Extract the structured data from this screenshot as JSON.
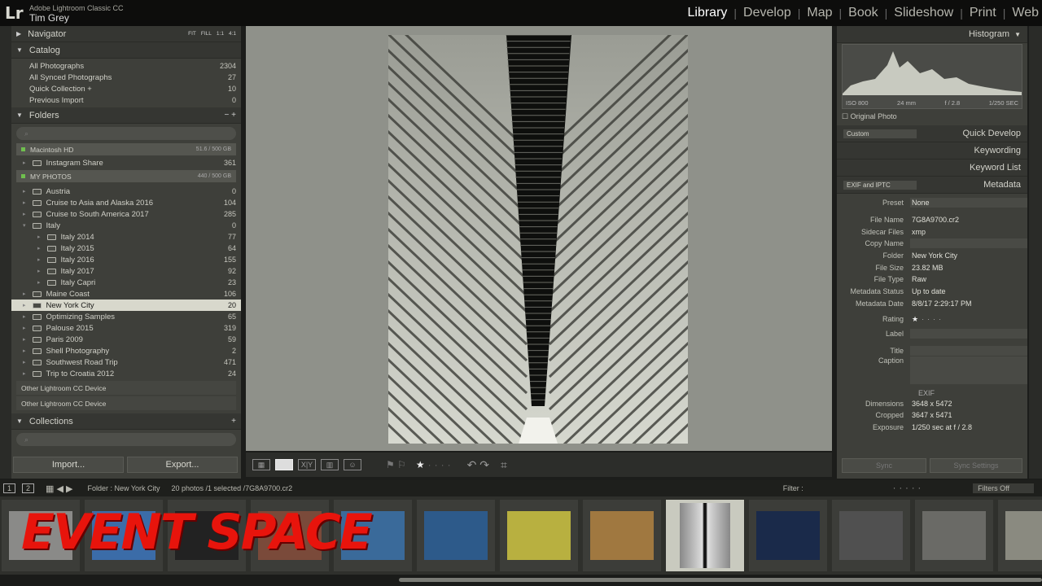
{
  "app": {
    "logo": "Lr",
    "name": "Adobe Lightroom Classic CC",
    "user": "Tim Grey"
  },
  "modules": [
    "Library",
    "Develop",
    "Map",
    "Book",
    "Slideshow",
    "Print",
    "Web"
  ],
  "active_module": "Library",
  "left_panel": {
    "navigator": {
      "label": "Navigator",
      "zoom": [
        "FIT",
        "FILL",
        "1:1",
        "4:1"
      ]
    },
    "catalog": {
      "label": "Catalog",
      "items": [
        {
          "label": "All Photographs",
          "count": "2304"
        },
        {
          "label": "All Synced Photographs",
          "count": "27"
        },
        {
          "label": "Quick Collection +",
          "count": "10"
        },
        {
          "label": "Previous Import",
          "count": "0"
        }
      ]
    },
    "folders": {
      "label": "Folders",
      "controls": "− +",
      "volumes": [
        {
          "label": "Macintosh HD",
          "size": "51.6 / 500 GB"
        },
        {
          "label": "MY PHOTOS",
          "size": "440 / 500 GB"
        }
      ],
      "hd_items": [
        {
          "label": "Instagram Share",
          "count": "361"
        }
      ],
      "items": [
        {
          "label": "Austria",
          "count": "0",
          "indent": 0
        },
        {
          "label": "Cruise to Asia and Alaska 2016",
          "count": "104",
          "indent": 0
        },
        {
          "label": "Cruise to South America 2017",
          "count": "285",
          "indent": 0
        },
        {
          "label": "Italy",
          "count": "0",
          "indent": 0
        },
        {
          "label": "Italy 2014",
          "count": "77",
          "indent": 1
        },
        {
          "label": "Italy 2015",
          "count": "64",
          "indent": 1
        },
        {
          "label": "Italy 2016",
          "count": "155",
          "indent": 1
        },
        {
          "label": "Italy 2017",
          "count": "92",
          "indent": 1
        },
        {
          "label": "Italy Capri",
          "count": "23",
          "indent": 1
        },
        {
          "label": "Maine Coast",
          "count": "106",
          "indent": 0
        },
        {
          "label": "New York City",
          "count": "20",
          "indent": 0,
          "selected": true
        },
        {
          "label": "Optimizing Samples",
          "count": "65",
          "indent": 0
        },
        {
          "label": "Palouse 2015",
          "count": "319",
          "indent": 0
        },
        {
          "label": "Paris 2009",
          "count": "59",
          "indent": 0
        },
        {
          "label": "Shell Photography",
          "count": "2",
          "indent": 0
        },
        {
          "label": "Southwest Road Trip",
          "count": "471",
          "indent": 0
        },
        {
          "label": "Trip to Croatia 2012",
          "count": "24",
          "indent": 0
        }
      ],
      "devices": [
        "Other Lightroom CC Device",
        "Other Lightroom CC Device"
      ]
    },
    "collections": {
      "label": "Collections",
      "control": "+"
    },
    "import_label": "Import...",
    "export_label": "Export..."
  },
  "right_panel": {
    "histogram": {
      "label": "Histogram",
      "iso": "ISO 800",
      "focal": "24 mm",
      "aperture": "f / 2.8",
      "shutter": "1/250 SEC",
      "original": "Original Photo"
    },
    "quick_develop": {
      "label": "Quick Develop",
      "preset": "Custom"
    },
    "keywording": "Keywording",
    "keyword_list": "Keyword List",
    "metadata": {
      "label": "Metadata",
      "set": "EXIF and IPTC",
      "preset_label": "Preset",
      "preset_value": "None",
      "fields": [
        {
          "k": "File Name",
          "v": "7G8A9700.cr2"
        },
        {
          "k": "Sidecar Files",
          "v": "xmp"
        },
        {
          "k": "Copy Name",
          "v": ""
        },
        {
          "k": "Folder",
          "v": "New York City"
        },
        {
          "k": "File Size",
          "v": "23.82 MB"
        },
        {
          "k": "File Type",
          "v": "Raw"
        },
        {
          "k": "Metadata Status",
          "v": "Up to date"
        },
        {
          "k": "Metadata Date",
          "v": "8/8/17 2:29:17 PM"
        }
      ],
      "rating_label": "Rating",
      "rating": 1,
      "label_label": "Label",
      "title_label": "Title",
      "caption_label": "Caption",
      "exif_label": "EXIF",
      "exif": [
        {
          "k": "Dimensions",
          "v": "3648 x 5472"
        },
        {
          "k": "Cropped",
          "v": "3647 x 5471"
        },
        {
          "k": "Exposure",
          "v": "1/250 sec at f / 2.8"
        }
      ]
    },
    "sync_label": "Sync",
    "sync_settings_label": "Sync Settings"
  },
  "filmstrip": {
    "screens": [
      "1",
      "2"
    ],
    "source": "Folder : New York City",
    "count": "20 photos /1 selected /",
    "filename": "7G8A9700.cr2",
    "filter_label": "Filter :",
    "filters_off": "Filters Off",
    "selected_index": 8,
    "thumb_count": 13
  },
  "overlay_text": "EVENT SPACE",
  "colors": {
    "accent_red": "#e8140c",
    "panel": "#3e3f3a",
    "selected_row": "#d8d8cc"
  }
}
